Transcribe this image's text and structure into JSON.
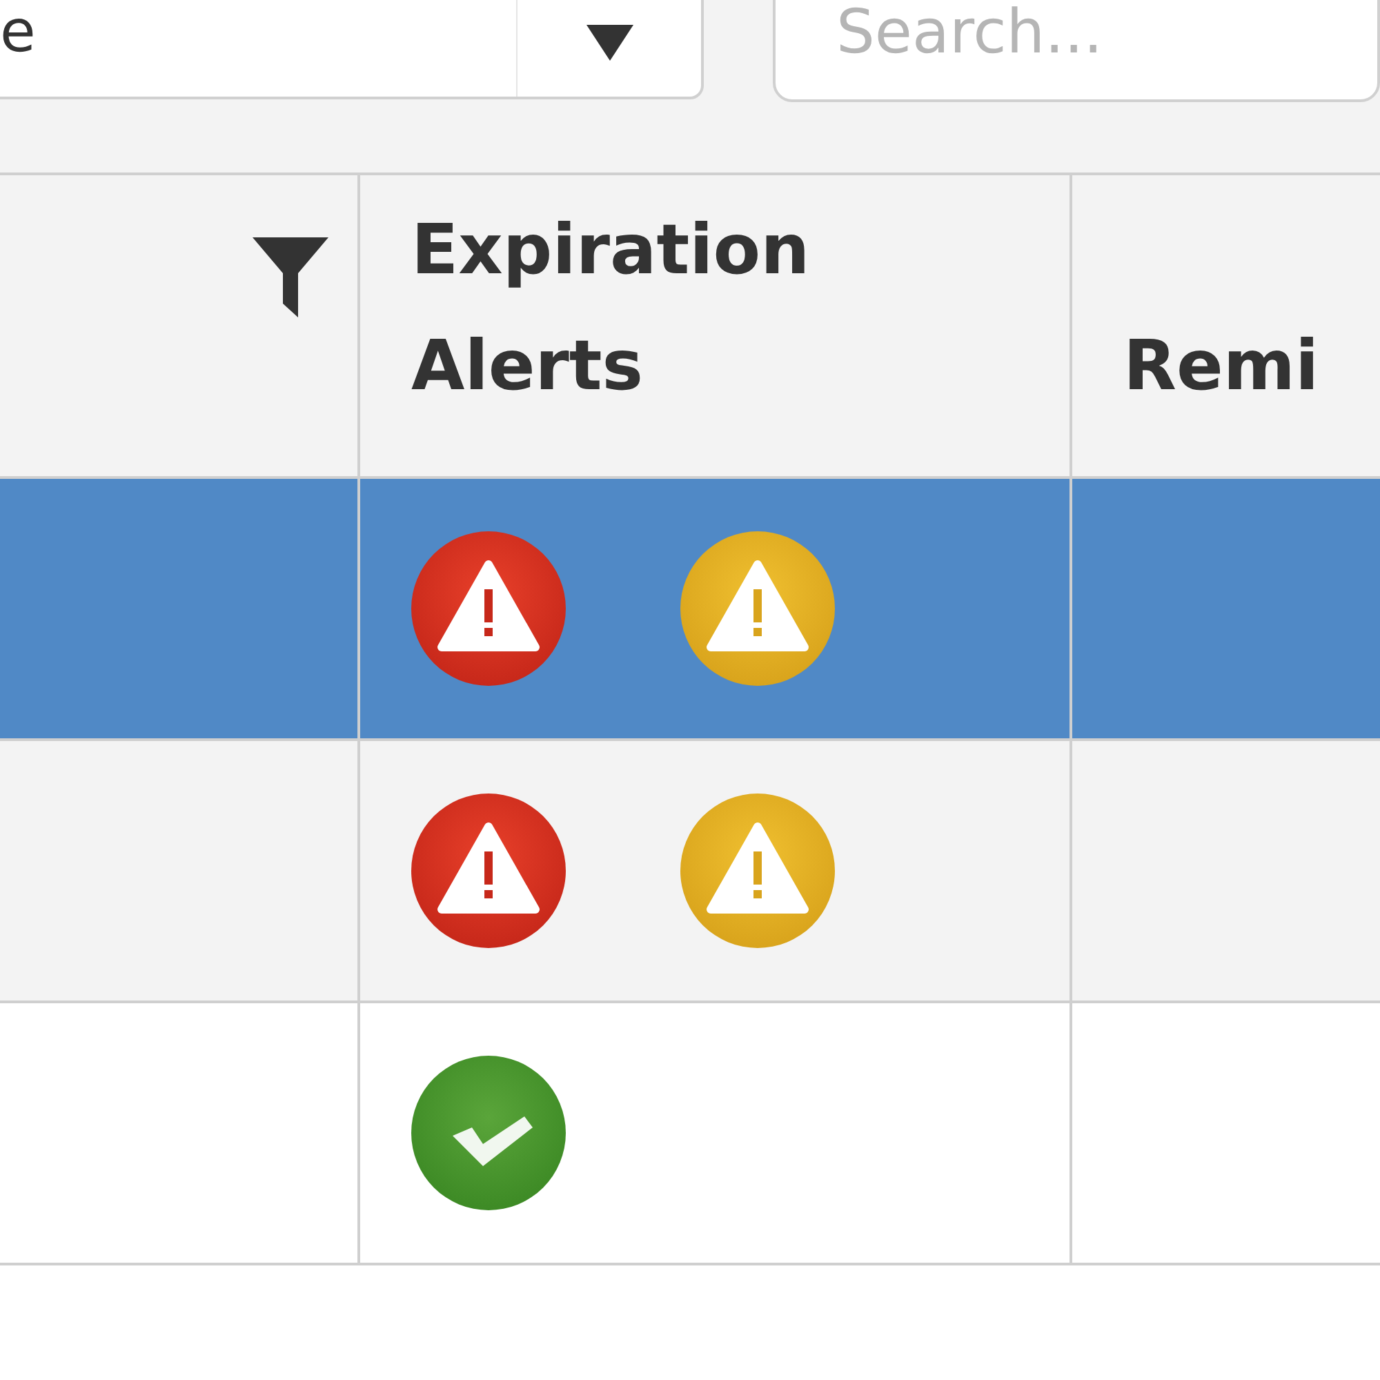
{
  "filter_bar": {
    "dropdown": {
      "value": "e"
    },
    "search": {
      "placeholder": "Search..."
    }
  },
  "table": {
    "columns": [
      {
        "filter": true
      },
      {
        "label": "Expiration Alerts",
        "filter": false
      },
      {
        "label": "Remi",
        "filter": false
      }
    ],
    "rows": [
      {
        "selected": true,
        "alerts": [
          {
            "kind": "error"
          },
          {
            "kind": "warning"
          }
        ]
      },
      {
        "selected": false,
        "alerts": [
          {
            "kind": "error"
          },
          {
            "kind": "warning"
          }
        ]
      },
      {
        "selected": false,
        "alerts": [
          {
            "kind": "ok"
          }
        ]
      }
    ]
  }
}
